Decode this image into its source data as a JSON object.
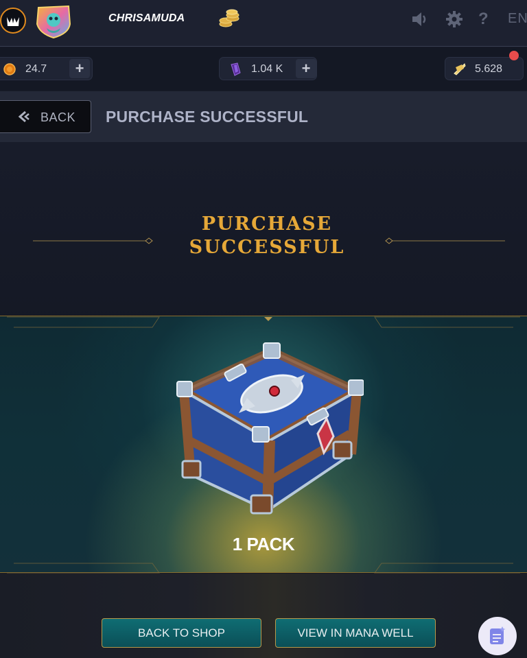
{
  "header": {
    "username": "CHRISAMUDA",
    "language": "EN",
    "icons": [
      "splinterlands-logo-icon",
      "avatar-icon",
      "coins-stack-icon",
      "sound-icon",
      "gear-icon",
      "help-icon"
    ]
  },
  "currencies": {
    "credits": {
      "value": "24.7",
      "icon": "credits-coin-icon"
    },
    "dec": {
      "value": "1.04 K",
      "icon": "dec-crystal-icon"
    },
    "sps": {
      "value": "5.628",
      "icon": "sps-icon"
    },
    "plus": "+"
  },
  "titlebar": {
    "back_label": "BACK",
    "title": "PURCHASE SUCCESSFUL"
  },
  "reward": {
    "heading_line1": "PURCHASE",
    "heading_line2": "SUCCESSFUL",
    "item_icon": "pack-chest-icon",
    "quantity_label": "1 PACK"
  },
  "actions": {
    "back_to_shop": "BACK TO SHOP",
    "view_in_mana_well": "VIEW IN MANA WELL"
  },
  "colors": {
    "accent_gold": "#e6a838",
    "button_teal": "#0f6d73",
    "notification_red": "#ea4c4c"
  }
}
